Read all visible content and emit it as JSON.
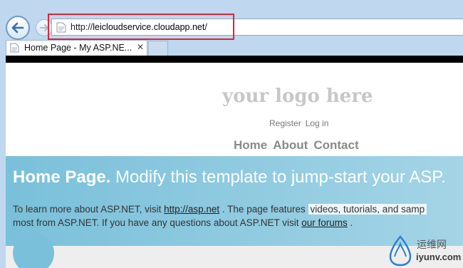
{
  "browser": {
    "address": {
      "protocol": "http://",
      "host": "leicloudservice.cloudapp.net",
      "suffix": "/"
    },
    "tab": {
      "title": "Home Page - My ASP.NE...",
      "close": "✕"
    }
  },
  "site": {
    "logo": "your logo here",
    "login": [
      "Register",
      "Log in"
    ],
    "menu": [
      "Home",
      "About",
      "Contact"
    ],
    "featured": {
      "title_bold": "Home Page.",
      "title_rest": " Modify this template to jump-start your ASP.",
      "line1_pre": "To learn more about ASP.NET, visit ",
      "line1_link": "http://asp.net",
      "line1_mid": " . The page features ",
      "line1_highlight": "videos, tutorials, and samp",
      "line2_pre": "most from ASP.NET. If you have any questions about ASP.NET visit ",
      "line2_link": "our forums",
      "line2_end": " ."
    }
  },
  "watermark": {
    "cn": "运维网",
    "url": "iyunv.com"
  },
  "colors": {
    "highlight_box": "#e12332",
    "featured_bg": "#7ac0da"
  }
}
